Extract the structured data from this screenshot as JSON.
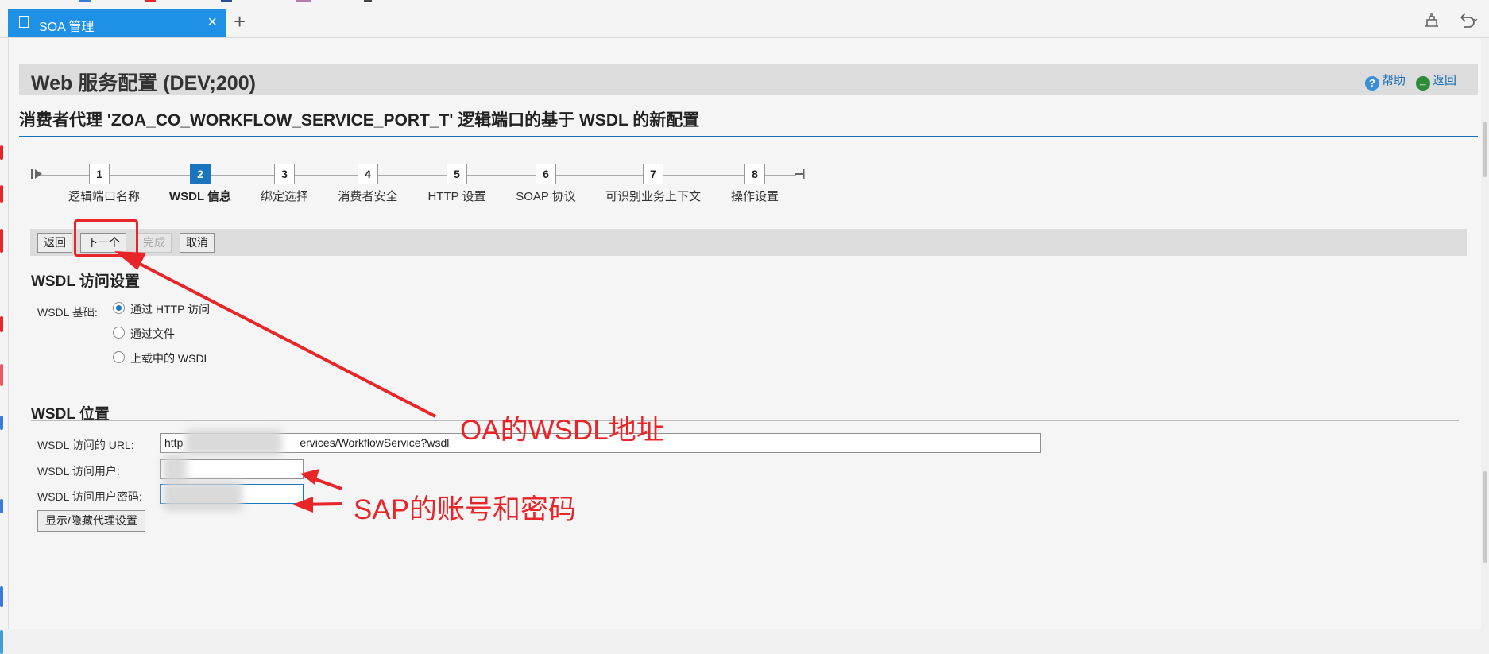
{
  "browser": {
    "tab_title": "SOA 管理",
    "close_glyph": "×",
    "newtab_glyph": "+",
    "tab_color": "#1e90e6"
  },
  "header": {
    "title": "Web 服务配置 (DEV;200)",
    "help_label": "帮助",
    "back_label": "返回"
  },
  "subtitle": "消费者代理 'ZOA_CO_WORKFLOW_SERVICE_PORT_T' 逻辑端口的基于 WSDL 的新配置",
  "roadmap": {
    "active_step": 2,
    "steps": [
      {
        "number": "1",
        "label": "逻辑端口名称"
      },
      {
        "number": "2",
        "label": "WSDL 信息"
      },
      {
        "number": "3",
        "label": "绑定选择"
      },
      {
        "number": "4",
        "label": "消费者安全"
      },
      {
        "number": "5",
        "label": "HTTP 设置"
      },
      {
        "number": "6",
        "label": "SOAP 协议"
      },
      {
        "number": "7",
        "label": "可识别业务上下文"
      },
      {
        "number": "8",
        "label": "操作设置"
      }
    ]
  },
  "toolbar": {
    "back": "返回",
    "next": "下一个",
    "finish": "完成",
    "cancel": "取消"
  },
  "wsdl_access": {
    "title": "WSDL 访问设置",
    "basis_label": "WSDL 基础:",
    "options": [
      "通过 HTTP 访问",
      "通过文件",
      "上载中的 WSDL"
    ],
    "selected": "通过 HTTP 访问"
  },
  "wsdl_location": {
    "title": "WSDL 位置",
    "url_label": "WSDL 访问的 URL:",
    "url_prefix": "http",
    "url_suffix": "ervices/WorkflowService?wsdl",
    "user_label": "WSDL 访问用户:",
    "password_label": "WSDL 访问用户密码:",
    "proxy_button": "显示/隐藏代理设置"
  },
  "annotations": {
    "oa_wsdl": "OA的WSDL地址",
    "sap_account": "SAP的账号和密码",
    "color": "#e8262a"
  },
  "colors": {
    "accent": "#1a75bc",
    "header_bg": "#dcdcdc"
  }
}
